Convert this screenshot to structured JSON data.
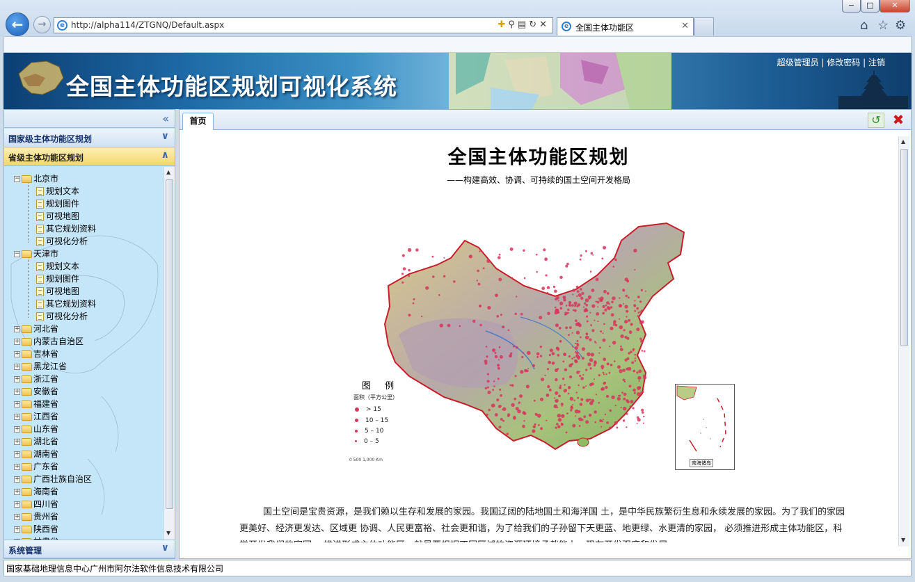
{
  "browser": {
    "url": "http://alpha114/ZTGNQ/Default.aspx",
    "tab_title": "全国主体功能区",
    "window_min": "−",
    "window_max": "□",
    "window_close": "✕"
  },
  "banner": {
    "title": "全国主体功能区规划可视化系统",
    "user_link": "超级管理员",
    "change_password_link": "修改密码",
    "logout_link": "注销",
    "separator": " | "
  },
  "sidebar": {
    "sections": [
      {
        "label": "国家级主体功能区规划",
        "expanded": false
      },
      {
        "label": "省级主体功能区规划",
        "expanded": true
      },
      {
        "label": "系统管理",
        "expanded": false
      }
    ],
    "tree": [
      {
        "label": "北京市",
        "expanded": true,
        "children": [
          "规划文本",
          "规划图件",
          "可视地图",
          "其它规划资料",
          "可视化分析"
        ]
      },
      {
        "label": "天津市",
        "expanded": true,
        "children": [
          "规划文本",
          "规划图件",
          "可视地图",
          "其它规划资料",
          "可视化分析"
        ]
      },
      {
        "label": "河北省"
      },
      {
        "label": "内蒙古自治区"
      },
      {
        "label": "吉林省"
      },
      {
        "label": "黑龙江省"
      },
      {
        "label": "浙江省"
      },
      {
        "label": "安徽省"
      },
      {
        "label": "福建省"
      },
      {
        "label": "江西省"
      },
      {
        "label": "山东省"
      },
      {
        "label": "湖北省"
      },
      {
        "label": "湖南省"
      },
      {
        "label": "广东省"
      },
      {
        "label": "广西壮族自治区"
      },
      {
        "label": "海南省"
      },
      {
        "label": "四川省"
      },
      {
        "label": "贵州省"
      },
      {
        "label": "陕西省"
      },
      {
        "label": "甘肃省"
      }
    ]
  },
  "main": {
    "tab_label": "首页",
    "doc_title": "全国主体功能区规划",
    "doc_subtitle": "——构建高效、协调、可持续的国土空间开发格局",
    "legend": {
      "title": "图 例",
      "unit": "面积（平方公里）",
      "items": [
        "> 15",
        "10 – 15",
        "5 – 10",
        "0 – 5"
      ]
    },
    "scale_label": "0      500     1,000 Km",
    "inset_label": "南海诸岛",
    "intro": "国土空间是宝贵资源，是我们赖以生存和发展的家园。我国辽阔的陆地国土和海洋国 土，是中华民族繁衍生息和永续发展的家园。为了我们的家园更美好、经济更发达、区域更 协调、人民更富裕、社会更和谐，为了给我们的子孙留下天更蓝、地更绿、水更清的家园， 必须推进形成主体功能区，科学开发我们的家园。 推进形成主体功能区，就是要根据不同区域的资源环境承载能力、现有开发强度和发展"
  },
  "footer": {
    "text": "国家基础地理信息中心广州市阿尔法软件信息技术有限公司"
  },
  "colors": {
    "accent": "#3a68a8",
    "selected_section": "#f4d56a",
    "sidebar_bg": "#c5e6f8",
    "map_dot": "#d8345c"
  }
}
